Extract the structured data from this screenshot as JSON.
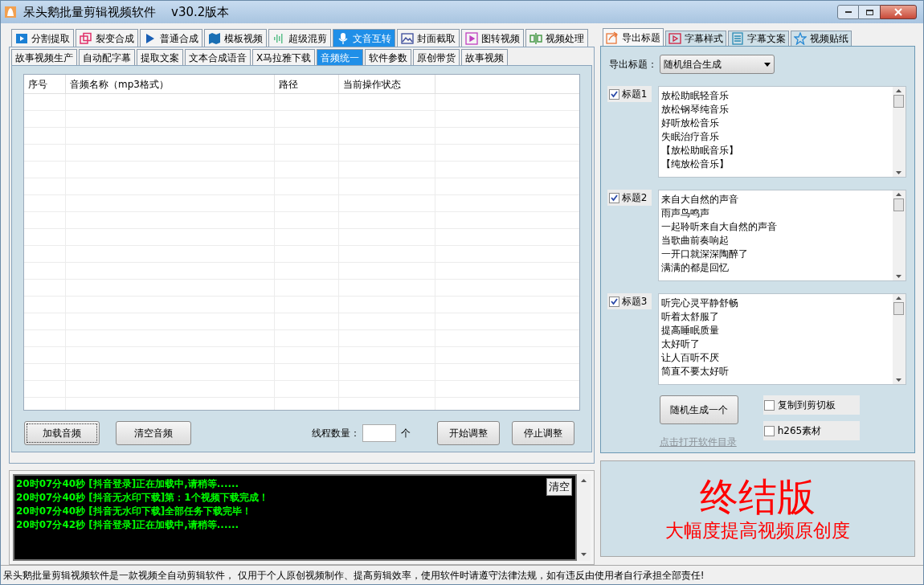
{
  "window": {
    "title": "呆头鹅批量剪辑视频软件    v30.2版本"
  },
  "main_tabs": [
    {
      "label": "分割提取",
      "selected": false
    },
    {
      "label": "裂变合成",
      "selected": false
    },
    {
      "label": "普通合成",
      "selected": false
    },
    {
      "label": "模板视频",
      "selected": false
    },
    {
      "label": "超级混剪",
      "selected": false
    },
    {
      "label": "文音互转",
      "selected": true
    },
    {
      "label": "封面截取",
      "selected": false
    },
    {
      "label": "图转视频",
      "selected": false
    },
    {
      "label": "视频处理",
      "selected": false
    }
  ],
  "sub_tabs": [
    {
      "label": "故事视频生产",
      "selected": false
    },
    {
      "label": "自动配字幕",
      "selected": false
    },
    {
      "label": "提取文案",
      "selected": false
    },
    {
      "label": "文本合成语音",
      "selected": false
    },
    {
      "label": "X马拉雅下载",
      "selected": false
    },
    {
      "label": "音频统一",
      "selected": true
    },
    {
      "label": "软件参数",
      "selected": false
    },
    {
      "label": "原创带货",
      "selected": false
    },
    {
      "label": "故事视频",
      "selected": false
    }
  ],
  "table": {
    "columns": [
      "序号",
      "音频名称（mp3格式）",
      "路径",
      "当前操作状态"
    ]
  },
  "buttons": {
    "load": "加载音频",
    "clear": "清空音频",
    "start": "开始调整",
    "stop": "停止调整"
  },
  "thread": {
    "label": "线程数量：",
    "unit": "个"
  },
  "log": {
    "clear_button": "清空",
    "lines": [
      "20时07分40秒 [抖音登录]正在加载中,请稍等......",
      "20时07分40秒 [抖音无水印下载]第：1个视频下载完成！",
      "20时07分40秒 [抖音无水印下载]全部任务下载完毕！",
      "20时07分42秒 [抖音登录]正在加载中,请稍等......"
    ]
  },
  "right_tabs": [
    {
      "label": "导出标题",
      "selected": true
    },
    {
      "label": "字幕样式",
      "selected": false
    },
    {
      "label": "字幕文案",
      "selected": false
    },
    {
      "label": "视频贴纸",
      "selected": false
    }
  ],
  "export": {
    "label": "导出标题：",
    "value": "随机组合生成"
  },
  "titles": [
    {
      "label": "标题1",
      "checked": true,
      "lines": [
        "放松助眠轻音乐",
        "放松钢琴纯音乐",
        "好听放松音乐",
        "失眠治疗音乐",
        "【放松助眠音乐】",
        "【纯放松音乐】"
      ]
    },
    {
      "label": "标题2",
      "checked": true,
      "lines": [
        "来自大自然的声音",
        "雨声鸟鸣声",
        "一起聆听来自大自然的声音",
        "当歌曲前奏响起",
        "一开口就深深陶醉了",
        "满满的都是回忆"
      ]
    },
    {
      "label": "标题3",
      "checked": true,
      "lines": [
        "听完心灵平静舒畅",
        "听着太舒服了",
        "提高睡眠质量",
        "太好听了",
        "让人百听不厌",
        "简直不要太好听"
      ]
    }
  ],
  "generate_button": "随机生成一个",
  "options": [
    {
      "label": "复制到剪切板",
      "checked": false
    },
    {
      "label": "h265素材",
      "checked": false
    }
  ],
  "open_dir_link": "点击打开软件目录",
  "banner": {
    "title": "终结版",
    "subtitle": "大幅度提高视频原创度"
  },
  "status_bar": "呆头鹅批量剪辑视频软件是一款视频全自动剪辑软件， 仅用于个人原创视频制作、提高剪辑效率，使用软件时请遵守法律法规，如有违反由使用者自行承担全部责任!"
}
